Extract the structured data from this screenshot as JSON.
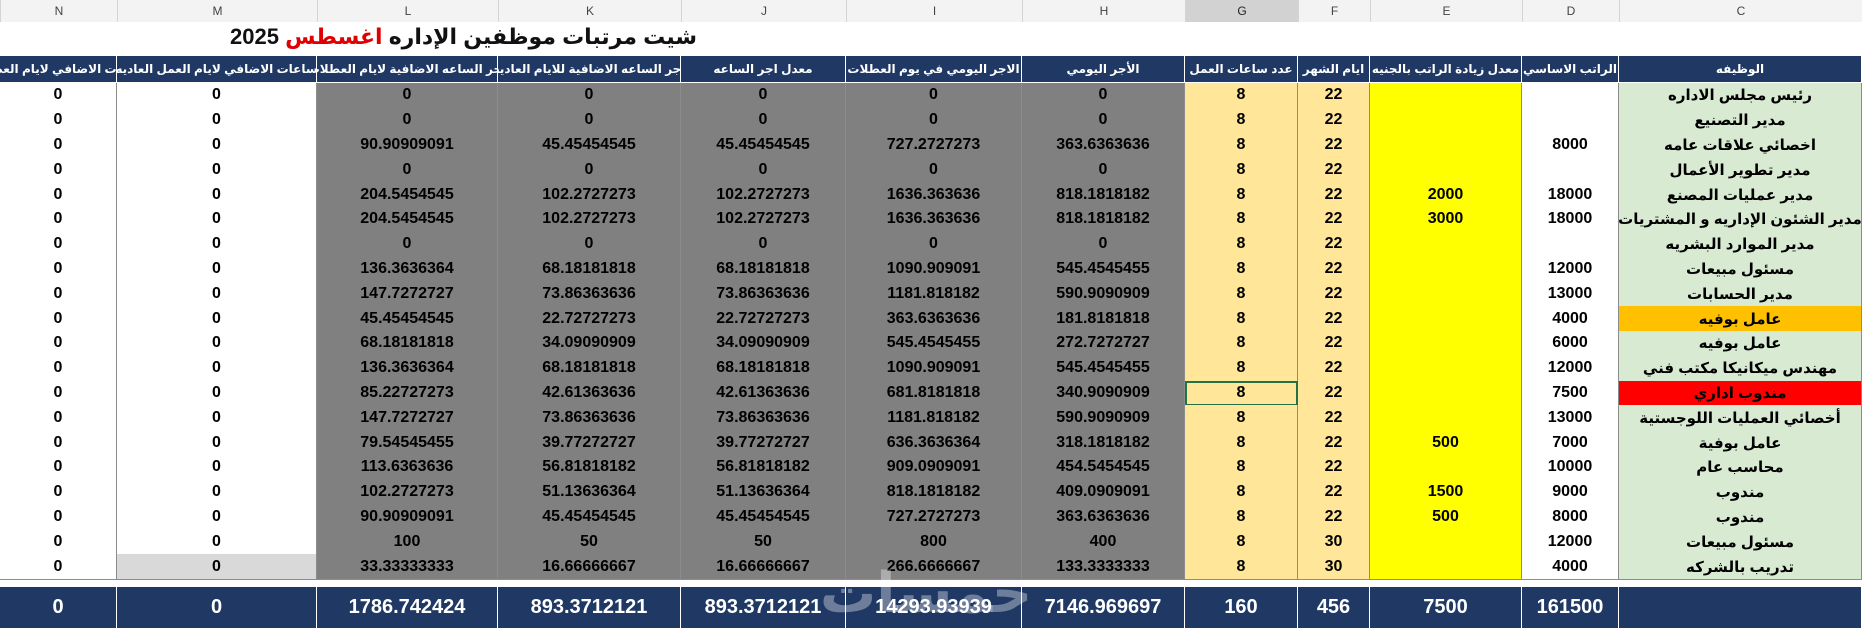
{
  "title": {
    "main": "شيت مرتبات موظفين الإداره ",
    "month": "اغسطس",
    "year": " 2025"
  },
  "columns": [
    "N",
    "M",
    "L",
    "K",
    "J",
    "I",
    "H",
    "G",
    "F",
    "E",
    "D",
    "C"
  ],
  "selected_column": "G",
  "headers": {
    "N": "ساعات الاضافي لايام العطلات",
    "M": "ساعات الاضافي لايام العمل العاديه",
    "L": "اجر الساعه الاضافية لايام العطلات",
    "K": "اجر الساعه الاضافية للايام العادية",
    "J": "معدل اجر الساعه",
    "I": "الاجر اليومي في يوم العطلات",
    "H": "الأجر اليومي",
    "G": "عدد ساعات العمل",
    "F": "ايام الشهر",
    "E": "معدل زيادة الراتب بالجنيه",
    "D": "الراتب الاساسي",
    "C": "الوظيفه"
  },
  "rows": [
    {
      "C": "رئيس مجلس الاداره",
      "D": "",
      "E": "",
      "F": "22",
      "G": "8",
      "H": "0",
      "I": "0",
      "J": "0",
      "K": "0",
      "L": "0",
      "M": "0",
      "N": "0",
      "jobColor": "#d9ead3"
    },
    {
      "C": "مدير التصنيع",
      "D": "",
      "E": "",
      "F": "22",
      "G": "8",
      "H": "0",
      "I": "0",
      "J": "0",
      "K": "0",
      "L": "0",
      "M": "0",
      "N": "0",
      "jobColor": "#d9ead3"
    },
    {
      "C": "اخصائي علاقات عامه",
      "D": "8000",
      "E": "",
      "F": "22",
      "G": "8",
      "H": "363.6363636",
      "I": "727.2727273",
      "J": "45.45454545",
      "K": "45.45454545",
      "L": "90.90909091",
      "M": "0",
      "N": "0",
      "jobColor": "#d9ead3"
    },
    {
      "C": "مدير تطوير الأعمال",
      "D": "",
      "E": "",
      "F": "22",
      "G": "8",
      "H": "0",
      "I": "0",
      "J": "0",
      "K": "0",
      "L": "0",
      "M": "0",
      "N": "0",
      "jobColor": "#d9ead3"
    },
    {
      "C": "مدير عمليات المصنع",
      "D": "18000",
      "E": "2000",
      "F": "22",
      "G": "8",
      "H": "818.1818182",
      "I": "1636.363636",
      "J": "102.2727273",
      "K": "102.2727273",
      "L": "204.5454545",
      "M": "0",
      "N": "0",
      "jobColor": "#d9ead3"
    },
    {
      "C": "مدير الشئون الإداريه و المشتريات",
      "D": "18000",
      "E": "3000",
      "F": "22",
      "G": "8",
      "H": "818.1818182",
      "I": "1636.363636",
      "J": "102.2727273",
      "K": "102.2727273",
      "L": "204.5454545",
      "M": "0",
      "N": "0",
      "jobColor": "#d9ead3"
    },
    {
      "C": "مدير الموارد البشريه",
      "D": "",
      "E": "",
      "F": "22",
      "G": "8",
      "H": "0",
      "I": "0",
      "J": "0",
      "K": "0",
      "L": "0",
      "M": "0",
      "N": "0",
      "jobColor": "#d9ead3"
    },
    {
      "C": "مسئول مبيعات",
      "D": "12000",
      "E": "",
      "F": "22",
      "G": "8",
      "H": "545.4545455",
      "I": "1090.909091",
      "J": "68.18181818",
      "K": "68.18181818",
      "L": "136.3636364",
      "M": "0",
      "N": "0",
      "jobColor": "#d9ead3"
    },
    {
      "C": "مدير الحسابات",
      "D": "13000",
      "E": "",
      "F": "22",
      "G": "8",
      "H": "590.9090909",
      "I": "1181.818182",
      "J": "73.86363636",
      "K": "73.86363636",
      "L": "147.7272727",
      "M": "0",
      "N": "0",
      "jobColor": "#d9ead3"
    },
    {
      "C": "عامل بوفيه",
      "D": "4000",
      "E": "",
      "F": "22",
      "G": "8",
      "H": "181.8181818",
      "I": "363.6363636",
      "J": "22.72727273",
      "K": "22.72727273",
      "L": "45.45454545",
      "M": "0",
      "N": "0",
      "jobColor": "#ffc000"
    },
    {
      "C": "عامل بوفيه",
      "D": "6000",
      "E": "",
      "F": "22",
      "G": "8",
      "H": "272.7272727",
      "I": "545.4545455",
      "J": "34.09090909",
      "K": "34.09090909",
      "L": "68.18181818",
      "M": "0",
      "N": "0",
      "jobColor": "#d9ead3"
    },
    {
      "C": "مهندس ميكانيكا مكتب فني",
      "D": "12000",
      "E": "",
      "F": "22",
      "G": "8",
      "H": "545.4545455",
      "I": "1090.909091",
      "J": "68.18181818",
      "K": "68.18181818",
      "L": "136.3636364",
      "M": "0",
      "N": "0",
      "jobColor": "#d9ead3"
    },
    {
      "C": "مندوب اداري",
      "D": "7500",
      "E": "",
      "F": "22",
      "G": "8",
      "H": "340.9090909",
      "I": "681.8181818",
      "J": "42.61363636",
      "K": "42.61363636",
      "L": "85.22727273",
      "M": "0",
      "N": "0",
      "jobColor": "#ff0000"
    },
    {
      "C": "أخصائي العمليات اللوجستية",
      "D": "13000",
      "E": "",
      "F": "22",
      "G": "8",
      "H": "590.9090909",
      "I": "1181.818182",
      "J": "73.86363636",
      "K": "73.86363636",
      "L": "147.7272727",
      "M": "0",
      "N": "0",
      "jobColor": "#d9ead3"
    },
    {
      "C": "عامل بوفية",
      "D": "7000",
      "E": "500",
      "F": "22",
      "G": "8",
      "H": "318.1818182",
      "I": "636.3636364",
      "J": "39.77272727",
      "K": "39.77272727",
      "L": "79.54545455",
      "M": "0",
      "N": "0",
      "jobColor": "#d9ead3"
    },
    {
      "C": "محاسب عام",
      "D": "10000",
      "E": "",
      "F": "22",
      "G": "8",
      "H": "454.5454545",
      "I": "909.0909091",
      "J": "56.81818182",
      "K": "56.81818182",
      "L": "113.6363636",
      "M": "0",
      "N": "0",
      "jobColor": "#d9ead3"
    },
    {
      "C": "مندوب",
      "D": "9000",
      "E": "1500",
      "F": "22",
      "G": "8",
      "H": "409.0909091",
      "I": "818.1818182",
      "J": "51.13636364",
      "K": "51.13636364",
      "L": "102.2727273",
      "M": "0",
      "N": "0",
      "jobColor": "#d9ead3"
    },
    {
      "C": "مندوب",
      "D": "8000",
      "E": "500",
      "F": "22",
      "G": "8",
      "H": "363.6363636",
      "I": "727.2727273",
      "J": "45.45454545",
      "K": "45.45454545",
      "L": "90.90909091",
      "M": "0",
      "N": "0",
      "jobColor": "#d9ead3"
    },
    {
      "C": "مسئول مبيعات",
      "D": "12000",
      "E": "",
      "F": "30",
      "G": "8",
      "H": "400",
      "I": "800",
      "J": "50",
      "K": "50",
      "L": "100",
      "M": "0",
      "N": "0",
      "jobColor": "#d9ead3"
    },
    {
      "C": "تدريب بالشركه",
      "D": "4000",
      "E": "",
      "F": "30",
      "G": "8",
      "H": "133.3333333",
      "I": "266.6666667",
      "J": "16.66666667",
      "K": "16.66666667",
      "L": "33.33333333",
      "M": "0",
      "N": "0",
      "jobColor": "#d9ead3"
    }
  ],
  "totals": {
    "N": "0",
    "M": "0",
    "L": "1786.742424",
    "K": "893.3712121",
    "J": "893.3712121",
    "I": "14293.93939",
    "H": "7146.969697",
    "G": "160",
    "F": "456",
    "E": "7500",
    "D": "161500",
    "C": ""
  },
  "watermark": "خمسات",
  "colors": {
    "header": "#1f3864",
    "gray": "#808080",
    "yellow": "#ffff00",
    "lightOrange": "#ffe699",
    "green": "#d9ead3",
    "orange": "#ffc000",
    "red": "#ff0000"
  }
}
